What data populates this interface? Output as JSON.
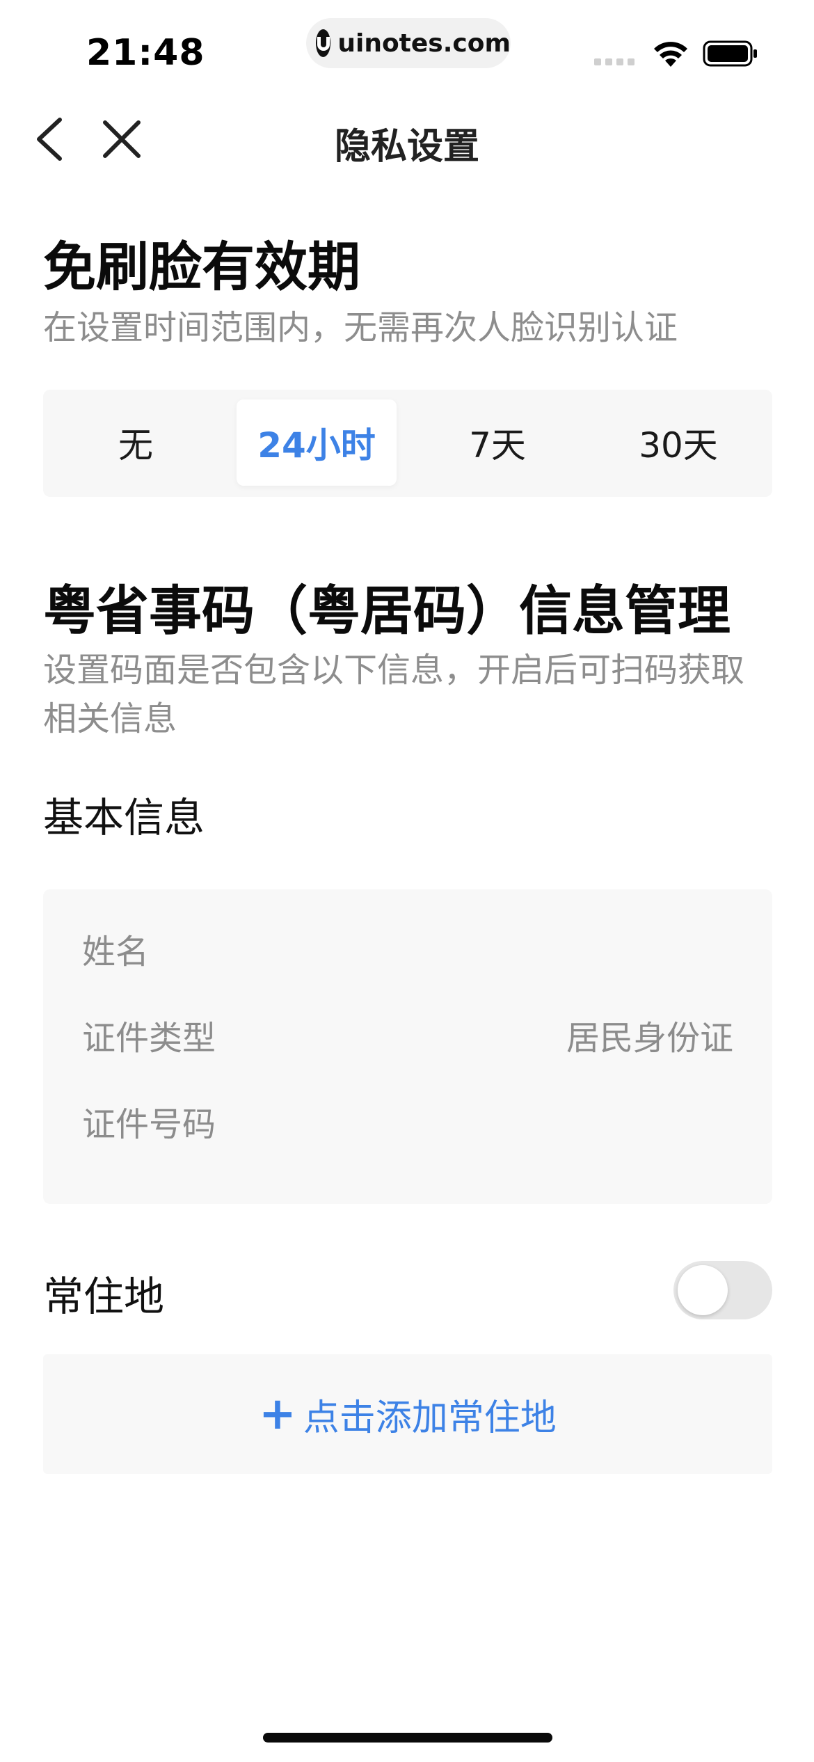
{
  "status_bar": {
    "time": "21:48",
    "url": "uinotes.com",
    "icons": [
      "signal-icon",
      "wifi-icon",
      "battery-icon"
    ]
  },
  "nav": {
    "title": "隐私设置",
    "back_icon": "chevron-left-icon",
    "close_icon": "close-icon"
  },
  "face_validity": {
    "title": "免刷脸有效期",
    "description": "在设置时间范围内，无需再次人脸识别认证",
    "options": [
      "无",
      "24小时",
      "7天",
      "30天"
    ],
    "selected": "24小时"
  },
  "code_info": {
    "title": "粤省事码（粤居码）信息管理",
    "description": "设置码面是否包含以下信息，开启后可扫码获取相关信息",
    "basic_info_label": "基本信息",
    "fields": [
      {
        "label": "姓名",
        "value": ""
      },
      {
        "label": "证件类型",
        "value": "居民身份证"
      },
      {
        "label": "证件号码",
        "value": ""
      }
    ]
  },
  "residence": {
    "label": "常住地",
    "toggle_on": false,
    "add_label": "点击添加常住地",
    "add_icon": "plus-icon"
  },
  "colors": {
    "accent": "#3d82e6",
    "muted_text": "#8d8d8d",
    "card_bg": "#f8f8f8"
  }
}
